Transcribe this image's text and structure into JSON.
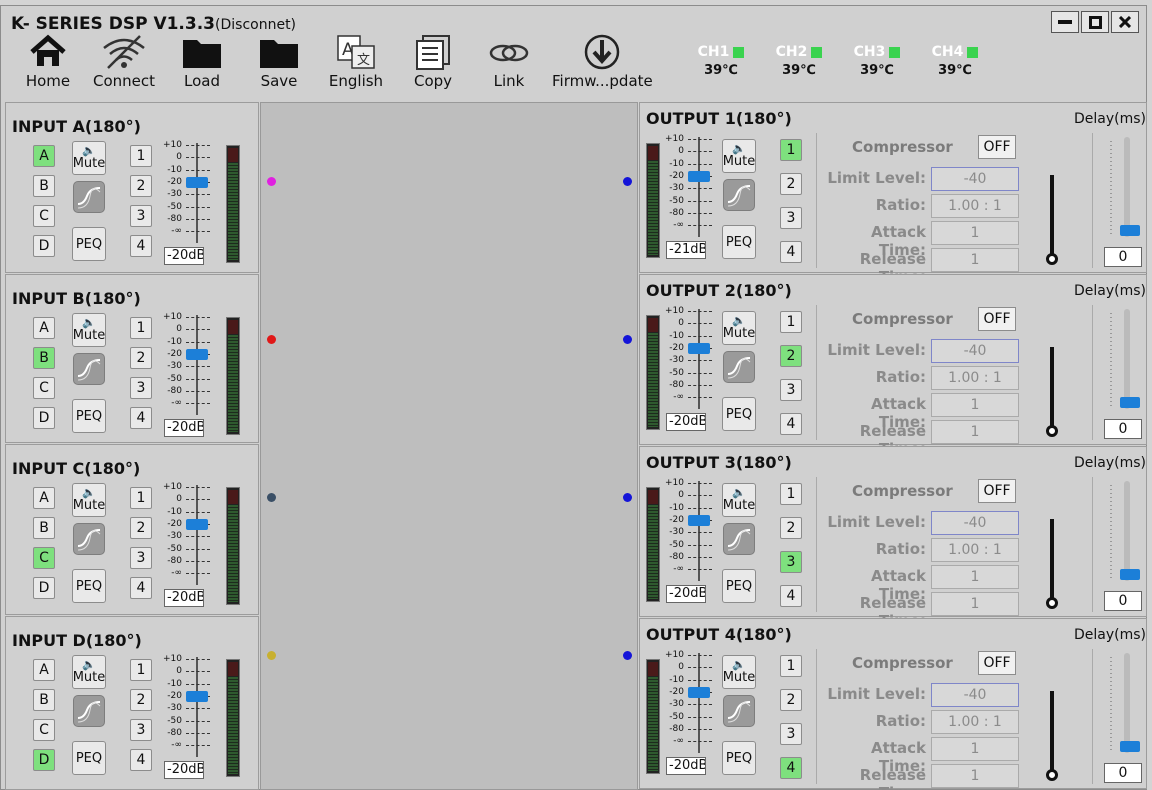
{
  "title": "K- SERIES DSP V1.3.3",
  "status": "(Disconnet)",
  "toolbar": [
    {
      "label": "Home",
      "icon": "home-icon"
    },
    {
      "label": "Connect",
      "icon": "wifi-off-icon"
    },
    {
      "label": "Load",
      "icon": "folder-icon"
    },
    {
      "label": "Save",
      "icon": "folder-icon"
    },
    {
      "label": "English",
      "icon": "translate-icon"
    },
    {
      "label": "Copy",
      "icon": "copy-icon"
    },
    {
      "label": "Link",
      "icon": "link-icon"
    },
    {
      "label": "Firmw...pdate",
      "icon": "download-icon"
    }
  ],
  "channels": [
    {
      "label": "CH1",
      "temp": "39℃"
    },
    {
      "label": "CH2",
      "temp": "39℃"
    },
    {
      "label": "CH3",
      "temp": "39℃"
    },
    {
      "label": "CH4",
      "temp": "39℃"
    }
  ],
  "scale_ticks": [
    "+10",
    "0",
    "-10",
    "-20",
    "-30",
    "-50",
    "-80",
    "-∞"
  ],
  "mute_label": "Mute",
  "peq_label": "PEQ",
  "inputs": [
    {
      "title": "INPUT A(180°)",
      "db": "-20dB",
      "active": "A",
      "dot_color": "#e020e0"
    },
    {
      "title": "INPUT B(180°)",
      "db": "-20dB",
      "active": "B",
      "dot_color": "#e01818"
    },
    {
      "title": "INPUT C(180°)",
      "db": "-20dB",
      "active": "C",
      "dot_color": "#3a4f66"
    },
    {
      "title": "INPUT D(180°)",
      "db": "-20dB",
      "active": "D",
      "dot_color": "#c8b030"
    }
  ],
  "input_src_labels": [
    "A",
    "B",
    "C",
    "D"
  ],
  "input_num_labels": [
    "1",
    "2",
    "3",
    "4"
  ],
  "outputs": [
    {
      "title": "OUTPUT 1(180°)",
      "db": "-21dB",
      "active": "1",
      "delay": "0"
    },
    {
      "title": "OUTPUT 2(180°)",
      "db": "-20dB",
      "active": "2",
      "delay": "0"
    },
    {
      "title": "OUTPUT 3(180°)",
      "db": "-20dB",
      "active": "3",
      "delay": "0"
    },
    {
      "title": "OUTPUT 4(180°)",
      "db": "-20dB",
      "active": "4",
      "delay": "0"
    }
  ],
  "compressor": {
    "label": "Compressor",
    "state": "OFF",
    "fields": [
      {
        "label": "Limit Level:",
        "value": "-40"
      },
      {
        "label": "Ratio:",
        "value": "1.00 : 1"
      },
      {
        "label": "Attack Time:",
        "value": "1"
      },
      {
        "label": "Release Time:",
        "value": "1"
      }
    ]
  },
  "delay_label": "Delay(ms)",
  "colors": {
    "led_green": "#3ad34f",
    "active_btn": "#7ee07e",
    "slider_blue": "#1c7fd8",
    "output_dot": "#1414d8"
  }
}
